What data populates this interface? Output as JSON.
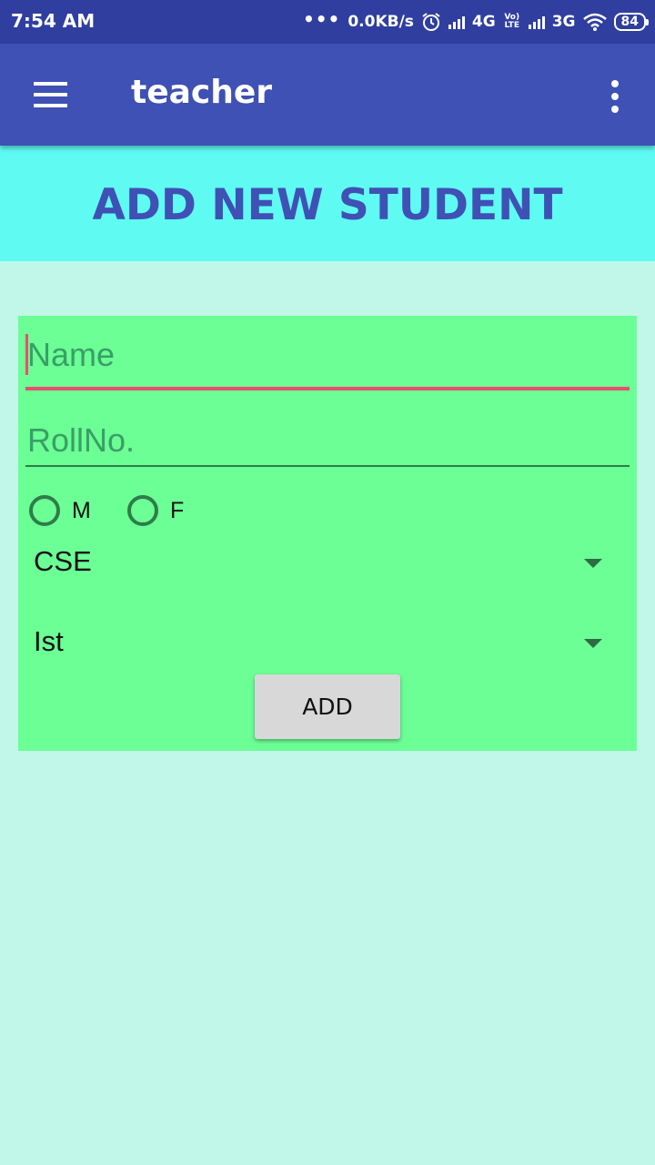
{
  "status_bar": {
    "time": "7:54 AM",
    "net_speed": "0.0KB/s",
    "network_1": "4G",
    "volte_top": "Vo)",
    "volte_bottom": "LTE",
    "network_2": "3G",
    "battery": "84"
  },
  "app_bar": {
    "title": "teacher",
    "background_color": "#3f51b5"
  },
  "page": {
    "title": "ADD NEW STUDENT",
    "heading_background": "#5ffbf2",
    "background_color": "#c0f7e8"
  },
  "form": {
    "background_color": "#6bff95",
    "name_field": {
      "placeholder": "Name",
      "value": ""
    },
    "rollno_field": {
      "placeholder": "RollNo.",
      "value": ""
    },
    "gender_options": [
      "M",
      "F"
    ],
    "department": {
      "selected": "CSE"
    },
    "year": {
      "selected": "Ist"
    },
    "add_label": "ADD"
  }
}
